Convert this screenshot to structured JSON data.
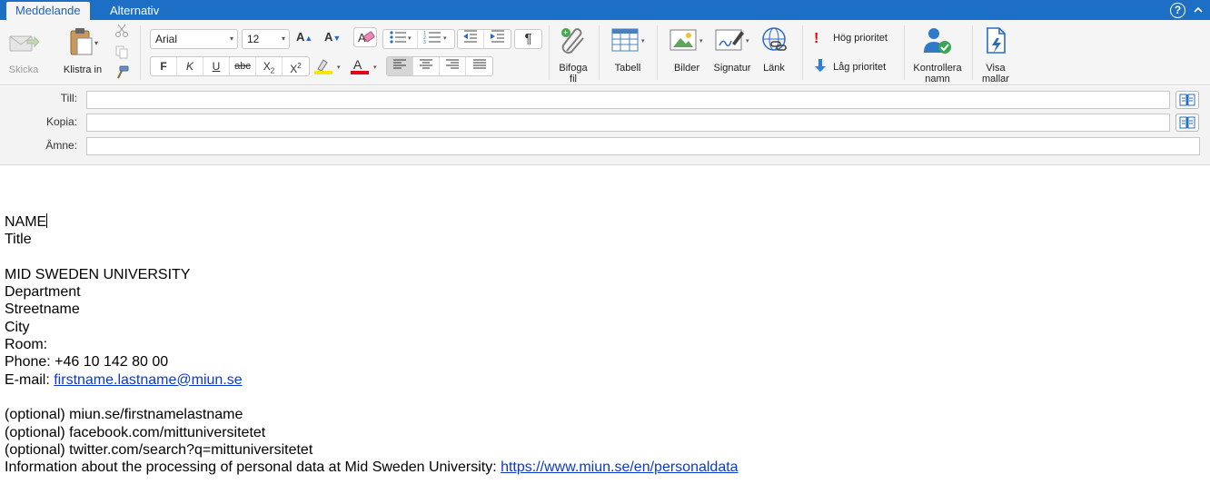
{
  "tabs": {
    "message": "Meddelande",
    "options": "Alternativ",
    "help": "?"
  },
  "ribbon": {
    "send": "Skicka",
    "paste": "Klistra in",
    "font_name": "Arial",
    "font_size": "12",
    "bold": "F",
    "italic": "K",
    "underline": "U",
    "strikethrough": "abc",
    "subscript": "X",
    "superscript": "X",
    "paragraph_mark": "¶",
    "attach_line1": "Bifoga",
    "attach_line2": "fil",
    "table": "Tabell",
    "pictures": "Bilder",
    "signature": "Signatur",
    "link": "Länk",
    "high_priority": "Hög prioritet",
    "low_priority": "Låg prioritet",
    "check_names_line1": "Kontrollera",
    "check_names_line2": "namn",
    "templates_line1": "Visa",
    "templates_line2": "mallar",
    "highlight_color": "#f7e600",
    "font_color": "#e0001a",
    "accent_color": "#1c6fc4"
  },
  "headers": {
    "to_label": "Till:",
    "to_value": "",
    "cc_label": "Kopia:",
    "cc_value": "",
    "subject_label": "Ämne:",
    "subject_value": ""
  },
  "body": {
    "name": "NAME",
    "title": "Title",
    "university": "MID SWEDEN UNIVERSITY",
    "department": "Department",
    "street": "Streetname",
    "city": "City",
    "room": "Room:",
    "phone": "Phone: +46 10 142 80 00",
    "email_label": "E-mail: ",
    "email_link": "firstname.lastname@miun.se",
    "optional_web": "(optional) miun.se/firstnamelastname",
    "optional_facebook": "(optional) facebook.com/mittuniversitetet",
    "optional_twitter": "(optional) twitter.com/search?q=mittuniversitetet",
    "privacy_text": "Information about the processing of personal data at Mid Sweden University: ",
    "privacy_link": "https://www.miun.se/en/personaldata"
  }
}
